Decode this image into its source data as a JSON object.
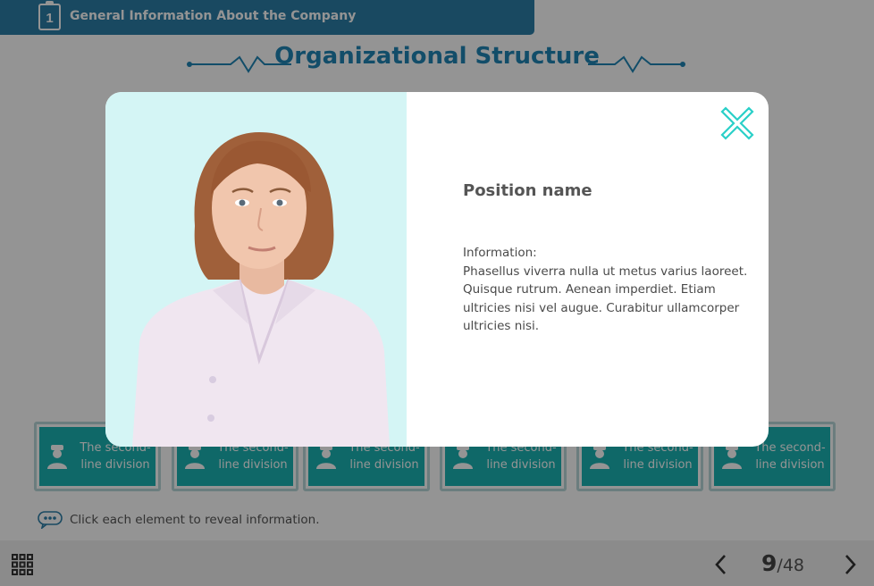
{
  "section": {
    "number": "1",
    "title": "General Information About the Company"
  },
  "slide": {
    "title": "Organizational Structure"
  },
  "divisions": [
    {
      "label": "The second-line division"
    },
    {
      "label": "The second-line division"
    },
    {
      "label": "The second-line division"
    },
    {
      "label": "The second-line division"
    },
    {
      "label": "The second-line division"
    },
    {
      "label": "The second-line division"
    }
  ],
  "hint": {
    "text": "Click each element to reveal information."
  },
  "footer": {
    "current_page": "9",
    "separator": "/",
    "total_pages": "48"
  },
  "modal": {
    "position_name": "Position name",
    "info_label": "Information:",
    "info_text": "Phasellus viverra nulla ut metus varius laoreet. Quisque rutrum. Aenean imperdiet. Etiam ultricies nisi vel augue. Curabitur ullamcorper ultricies nisi."
  },
  "colors": {
    "accent_blue": "#2c7fa8",
    "title_blue": "#1f86b6",
    "teal": "#1bb3b3",
    "close_teal": "#2ad0c8",
    "photo_bg": "#d4f5f5"
  },
  "icons": {
    "section": "clipboard-icon",
    "division": "user-icon",
    "hint": "speech-bubble-icon",
    "menu": "grid-menu-icon",
    "prev": "chevron-left-icon",
    "next": "chevron-right-icon",
    "close": "close-icon"
  }
}
